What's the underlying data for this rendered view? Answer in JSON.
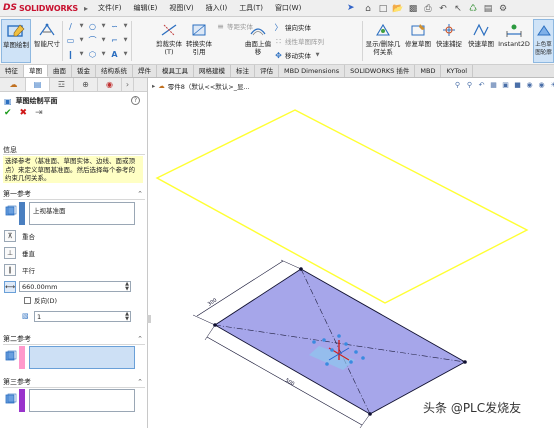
{
  "app": {
    "logo_ds": "DS",
    "logo_name": "SOLIDWORKS"
  },
  "menu": [
    "文件(F)",
    "编辑(E)",
    "视图(V)",
    "插入(I)",
    "工具(T)",
    "窗口(W)"
  ],
  "command": {
    "sketch_draw": "草图绘制",
    "smart_dim": "智能尺寸",
    "trim": "剪裁实体(T)",
    "convert": "转换实体引用",
    "offset": "等距实体",
    "surface_offset": "曲面上偏移",
    "mirror": "镜向实体",
    "linear_pattern": "线性草图阵列",
    "move": "移动实体",
    "show_hide": "显示/删除几何关系",
    "repair": "修复草图",
    "quick_snap": "快速捕捉",
    "rapid_sketch": "快速草图",
    "instant2d": "Instant2D",
    "shaded_sketch": "上色草图轮廓"
  },
  "tabs": [
    "特征",
    "草图",
    "曲面",
    "钣金",
    "结构系统",
    "焊件",
    "模具工具",
    "网格建模",
    "标注",
    "评估",
    "MBD Dimensions",
    "SOLIDWORKS 插件",
    "MBD",
    "KYTool"
  ],
  "active_tab": "草图",
  "panel": {
    "title": "草图绘制平面",
    "help": "?",
    "info_header": "信息",
    "info_text": "选择参考（基准面、草图实体、边线、面或顶点）来定义草图基准面。然后选择每个参考的约束几何关系。",
    "first_ref_header": "第一参考",
    "first_ref_value": "上视基准面",
    "constraints": [
      "重合",
      "垂直",
      "平行"
    ],
    "distance_value": "660.00mm",
    "flip_label": "反向(D)",
    "count_value": "1",
    "second_ref_header": "第二参考",
    "third_ref_header": "第三参考"
  },
  "graphics": {
    "breadcrumb": "零件8（默认<<默认>_显...",
    "dim_short": "300",
    "dim_long": "500",
    "watermark": "头条 @PLC发烧友"
  },
  "colors": {
    "accent": "#2c6fc0",
    "active_tab_bg": "#cfe3f7",
    "info_bg": "#ffffc4",
    "first_ref": "#4a7fc0",
    "second_ref": "#ff99cc",
    "third_ref": "#9933cc",
    "sketch_plane": "#ffff33",
    "part_face": "#a6a6ea"
  }
}
